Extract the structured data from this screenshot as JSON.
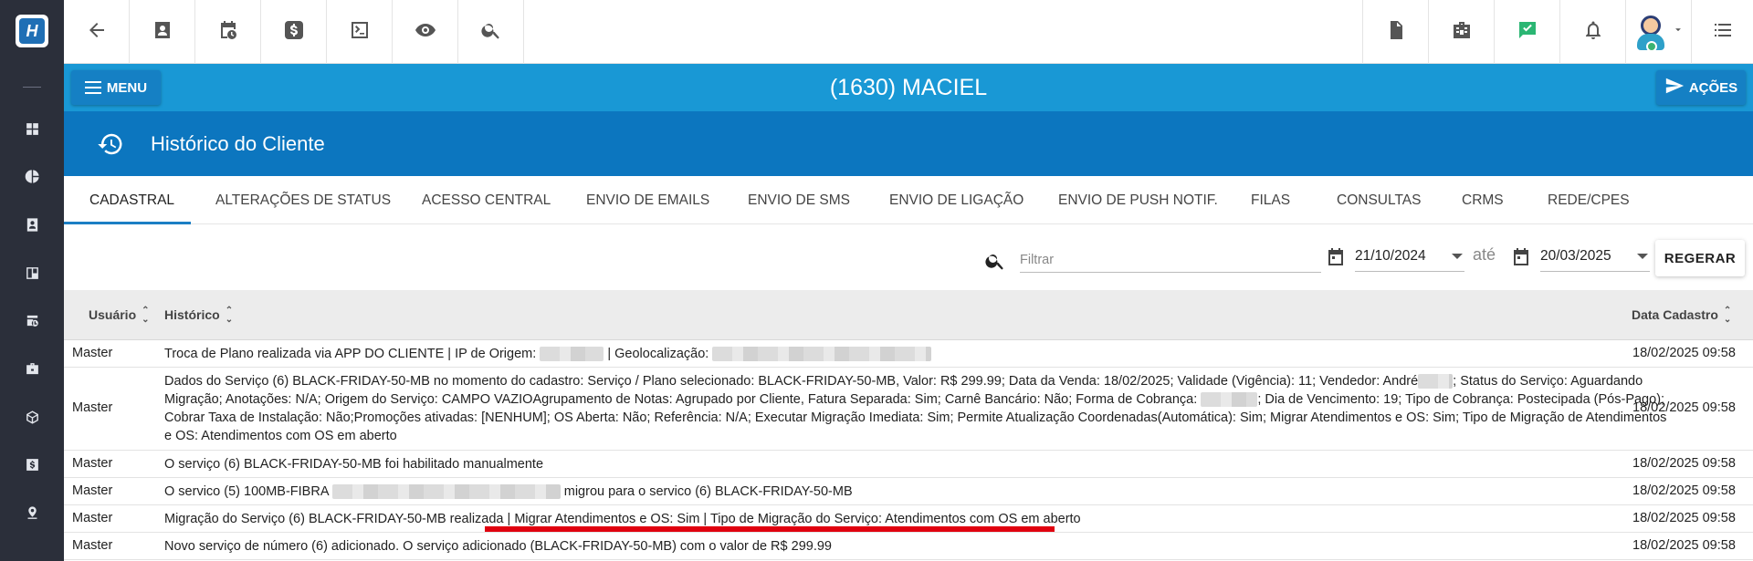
{
  "header": {
    "client_title": "(1630) MACIEL",
    "menu_label": "MENU",
    "acoes_label": "AÇÕES"
  },
  "page": {
    "title": "Histórico do Cliente"
  },
  "tabs": [
    {
      "label": "CADASTRAL",
      "active": true
    },
    {
      "label": "ALTERAÇÕES DE STATUS"
    },
    {
      "label": "ACESSO CENTRAL"
    },
    {
      "label": "ENVIO DE EMAILS"
    },
    {
      "label": "ENVIO DE SMS"
    },
    {
      "label": "ENVIO DE LIGAÇÃO"
    },
    {
      "label": "ENVIO DE PUSH NOTIF."
    },
    {
      "label": "FILAS"
    },
    {
      "label": "CONSULTAS"
    },
    {
      "label": "CRMS"
    },
    {
      "label": "REDE/CPES"
    }
  ],
  "filter": {
    "placeholder": "Filtrar",
    "date_from": "21/10/2024",
    "date_to": "20/03/2025",
    "ate_label": "até",
    "regerar_label": "REGERAR"
  },
  "table": {
    "columns": {
      "usuario": "Usuário",
      "historico": "Histórico",
      "data_cadastro": "Data Cadastro"
    },
    "rows": [
      {
        "user": "Master",
        "hist_a": "Troca de Plano realizada via APP DO CLIENTE | IP de Origem:",
        "hist_b": "| Geolocalização:",
        "date": "18/02/2025 09:58"
      },
      {
        "user": "Master",
        "line1a": "Dados do Serviço (6) BLACK-FRIDAY-50-MB no momento do cadastro: Serviço / Plano selecionado: BLACK-FRIDAY-50-MB, Valor: R$ 299.99; Data da Venda: 18/02/2025; Validade (Vigência): 11; Vendedor: André",
        "line1b": "; Status do Serviço: Aguardando",
        "line2a": "Migração; Anotações: N/A; Origem do Serviço: CAMPO VAZIOAgrupamento de Notas: Agrupado por Cliente, Fatura Separada: Sim; Carnê Bancário: Não; Forma de Cobrança:",
        "line2b": "; Dia de Vencimento: 19; Tipo de Cobrança: Postecipada (Pós-Pago);",
        "line3": "Cobrar Taxa de Instalação: Não;Promoções ativadas: [NENHUM]; OS Aberta: Não; Referência: N/A; Executar Migração Imediata: Sim; Permite Atualização Coordenadas(Automática): Sim; Migrar Atendimentos e OS: Sim; Tipo de Migração de Atendimentos",
        "line4": "e OS: Atendimentos com OS em aberto",
        "date": "18/02/2025 09:58"
      },
      {
        "user": "Master",
        "hist": "O serviço (6) BLACK-FRIDAY-50-MB foi habilitado manualmente",
        "date": "18/02/2025 09:58"
      },
      {
        "user": "Master",
        "hist_a": "O servico (5) 100MB-FIBRA",
        "hist_b": "migrou para o servico (6) BLACK-FRIDAY-50-MB",
        "date": "18/02/2025 09:58"
      },
      {
        "user": "Master",
        "hist": "Migração do Serviço (6) BLACK-FRIDAY-50-MB realizada | Migrar Atendimentos e OS: Sim | Tipo de Migração do Serviço: Atendimentos com OS em aberto",
        "date": "18/02/2025 09:58"
      },
      {
        "user": "Master",
        "hist": "Novo serviço de número (6) adicionado. O serviço adicionado (BLACK-FRIDAY-50-MB) com o valor de R$ 299.99",
        "date": "18/02/2025 09:58"
      }
    ]
  },
  "colors": {
    "sidebar": "#2b2f3a",
    "blue_bar": "#1998d5",
    "title_bar": "#0c76bf",
    "highlight_red": "#e0000f",
    "chat_green": "#2bb673"
  },
  "icons": {
    "sidebar": [
      "dashboard-icon",
      "pie-chart-icon",
      "contact-icon",
      "board-icon",
      "calendar-clock-icon",
      "briefcase-icon",
      "cube-icon",
      "dollar-icon",
      "map-pin-icon"
    ],
    "toolbar": [
      "back-arrow-icon",
      "contact-card-icon",
      "calendar-clock-icon",
      "dollar-icon",
      "terminal-icon",
      "eye-icon",
      "search-icon",
      "pdf-icon",
      "building-icon",
      "chat-check-icon",
      "bell-icon",
      "avatar",
      "list-icon"
    ]
  }
}
